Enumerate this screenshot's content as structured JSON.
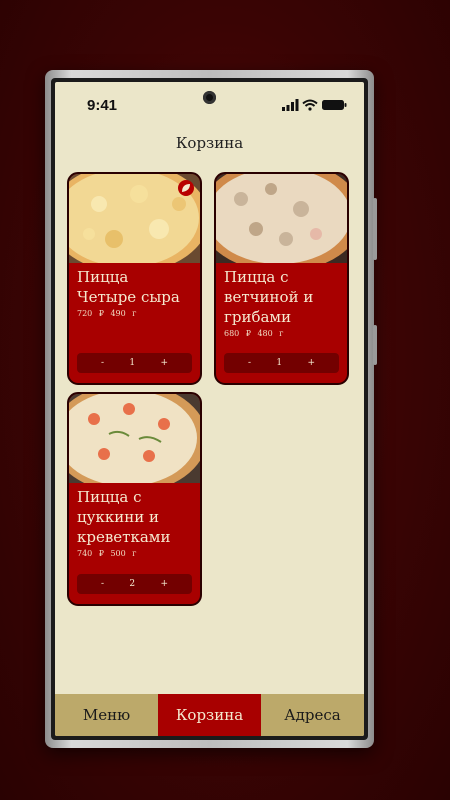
{
  "status": {
    "time": "9:41"
  },
  "header": {
    "title": "Корзина"
  },
  "cart": {
    "items": [
      {
        "name": "Пицца Четыре сыра",
        "price": "720 ₽",
        "weight": "490 г",
        "minus": "-",
        "qty": "1",
        "plus": "+"
      },
      {
        "name": "Пицца с ветчиной и грибами",
        "price": "680 ₽",
        "weight": "480 г",
        "minus": "-",
        "qty": "1",
        "plus": "+"
      },
      {
        "name": "Пицца с цуккини и креветками",
        "price": "740 ₽",
        "weight": "500 г",
        "minus": "-",
        "qty": "2",
        "plus": "+"
      }
    ]
  },
  "tabs": [
    {
      "label": "Меню",
      "active": false
    },
    {
      "label": "Корзина",
      "active": true
    },
    {
      "label": "Адреса",
      "active": false
    }
  ],
  "colors": {
    "accent": "#a80000",
    "tab_bg": "#bca96a",
    "screen_bg": "#ebe6c9"
  },
  "icons": {
    "card_badge": "leaf-icon",
    "signal": "signal-icon",
    "wifi": "wifi-icon",
    "battery": "battery-icon"
  }
}
